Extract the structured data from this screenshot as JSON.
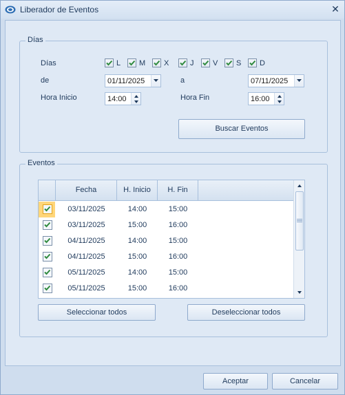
{
  "window": {
    "title": "Liberador de Eventos",
    "close_glyph": "✕"
  },
  "dias_group": {
    "title": "Días",
    "days_label": "Días",
    "days": [
      {
        "letter": "L",
        "checked": true
      },
      {
        "letter": "M",
        "checked": true
      },
      {
        "letter": "X",
        "checked": true
      },
      {
        "letter": "J",
        "checked": true
      },
      {
        "letter": "V",
        "checked": true
      },
      {
        "letter": "S",
        "checked": true
      },
      {
        "letter": "D",
        "checked": true
      }
    ],
    "from_label": "de",
    "from_date": "01/11/2025",
    "to_label": "a",
    "to_date": "07/11/2025",
    "start_label": "Hora Inicio",
    "start_time": "14:00",
    "end_label": "Hora Fin",
    "end_time": "16:00",
    "search_button": "Buscar Eventos"
  },
  "eventos_group": {
    "title": "Eventos",
    "columns": [
      "Fecha",
      "H. Inicio",
      "H. Fin"
    ],
    "rows": [
      {
        "fecha": "03/11/2025",
        "inicio": "14:00",
        "fin": "15:00",
        "checked": true
      },
      {
        "fecha": "03/11/2025",
        "inicio": "15:00",
        "fin": "16:00",
        "checked": true
      },
      {
        "fecha": "04/11/2025",
        "inicio": "14:00",
        "fin": "15:00",
        "checked": true
      },
      {
        "fecha": "04/11/2025",
        "inicio": "15:00",
        "fin": "16:00",
        "checked": true
      },
      {
        "fecha": "05/11/2025",
        "inicio": "14:00",
        "fin": "15:00",
        "checked": true
      },
      {
        "fecha": "05/11/2025",
        "inicio": "15:00",
        "fin": "16:00",
        "checked": true
      }
    ],
    "select_all_button": "Seleccionar todos",
    "deselect_all_button": "Deseleccionar todos"
  },
  "footer": {
    "accept_button": "Aceptar",
    "cancel_button": "Cancelar"
  },
  "colors": {
    "check": "#2f8a3e",
    "accent": "#e3a21a",
    "window": "#cfddee"
  }
}
